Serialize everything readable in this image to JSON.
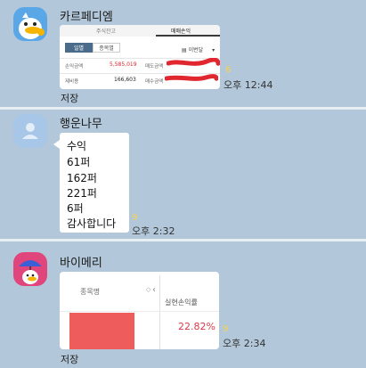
{
  "messages": [
    {
      "sender": "카르페디엠",
      "unread": "6",
      "time": "오후 12:44",
      "save_label": "저장",
      "image": {
        "tabs": [
          "주식잔고",
          "매매손익"
        ],
        "segments": [
          "일별",
          "종목별"
        ],
        "period": "이번달",
        "rows": [
          {
            "label": "손익금액",
            "value": "5,585,019",
            "label2": "매도금액"
          },
          {
            "label": "제비용",
            "value": "166,603",
            "label2": "매수금액"
          }
        ]
      }
    },
    {
      "sender": "행운나무",
      "unread": "9",
      "time": "오후 2:32",
      "lines": [
        "수익",
        "61퍼",
        "162퍼",
        "221퍼",
        "6퍼",
        "감사합니다"
      ]
    },
    {
      "sender": "바이메리",
      "unread": "9",
      "time": "오후 2:34",
      "save_label": "저장",
      "image": {
        "col_name": "종목명",
        "sort_symbol": "◇",
        "col_rate": "실현손익률",
        "rate": "22.82%"
      }
    }
  ],
  "colors": {
    "background": "#b2c7d9",
    "divider": "#e9eef3",
    "profit_red": "#e0262e",
    "redaction": "#ef5c5c"
  },
  "icons": {
    "avatar1": "duck-character-avatar",
    "avatar2": "default-person-avatar",
    "avatar3": "duck-umbrella-avatar"
  }
}
